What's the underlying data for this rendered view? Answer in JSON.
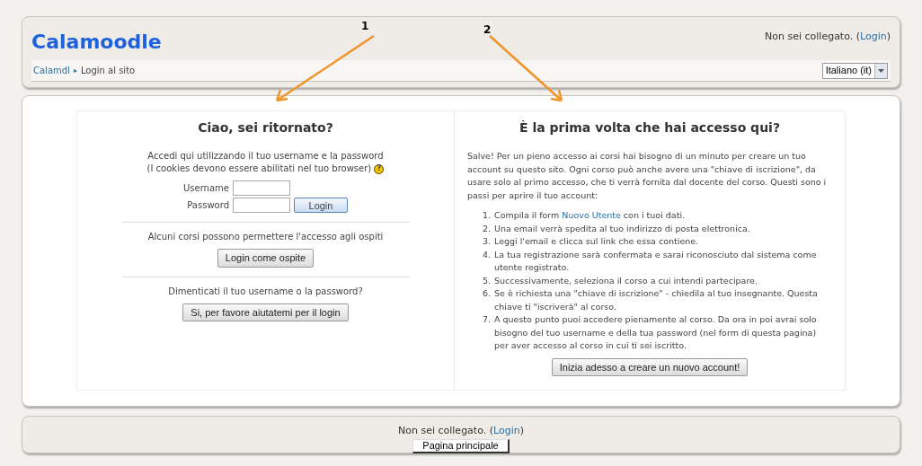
{
  "header": {
    "title": "Calamoodle",
    "login_info": {
      "before": "Non sei collegato. (",
      "link": "Login",
      "after": ")"
    },
    "breadcrumb": [
      {
        "label": "Calamdl",
        "link": true
      },
      {
        "label": "Login al sito",
        "link": false
      }
    ],
    "separator": "▸",
    "language": "Italiano (it)"
  },
  "login_panel": {
    "heading": "Ciao, sei ritornato?",
    "intro": [
      "Accedi qui utilizzando il tuo username e la password",
      "(I cookies devono essere abilitati nel tuo browser)"
    ],
    "help": "?",
    "fields": [
      {
        "label": "Username"
      },
      {
        "label": "Password"
      }
    ],
    "login_button": "Login",
    "guest_text": "Alcuni corsi possono permettere l'accesso agli ospiti",
    "guest_button": "Login come ospite",
    "forgot_text": "Dimenticati il tuo username o la password?",
    "forgot_button": "Si, per favore aiutatemi per il login"
  },
  "signup_panel": {
    "heading": "È la prima volta che hai accesso qui?",
    "intro": "Salve! Per un pieno accesso ai corsi hai bisogno di un minuto per creare un tuo account su questo sito. Ogni corso può anche avere una \"chiave di iscrizione\", da usare solo al primo accesso, che ti verrà fornita dal docente del corso. Questi sono i passi per aprire il tuo account:",
    "steps": [
      {
        "number": "1.",
        "before": "Compila il form ",
        "link": "Nuovo Utente",
        "after": " con i tuoi dati."
      },
      {
        "number": "2.",
        "before": "Una email verrà spedita al tuo indirizzo di posta elettronica."
      },
      {
        "number": "3.",
        "before": "Leggi l'email e clicca sul link che essa contiene."
      },
      {
        "number": "4.",
        "before": "La tua registrazione sarà confermata e sarai riconosciuto dal sistema come utente registrato."
      },
      {
        "number": "5.",
        "before": "Successivamente, seleziona il corso a cui intendi partecipare."
      },
      {
        "number": "6.",
        "before": "Se è richiesta una \"chiave di iscrizione\" - chiedila al tuo insegnante. Questa chiave ti \"iscriverà\" al corso."
      },
      {
        "number": "7.",
        "before": "A questo punto puoi accedere pienamente al corso. Da ora in poi avrai solo bisogno del tuo username e della tua password (nel form di questa pagina) per aver accesso al corso in cui ti sei iscritto."
      }
    ],
    "button": "Inizia adesso a creare un nuovo account!"
  },
  "footer": {
    "login_info": {
      "before": "Non sei collegato. (",
      "link": "Login",
      "after": ")"
    },
    "home_button": "Pagina principale"
  },
  "annotations": [
    {
      "label": "1"
    },
    {
      "label": "2"
    }
  ]
}
